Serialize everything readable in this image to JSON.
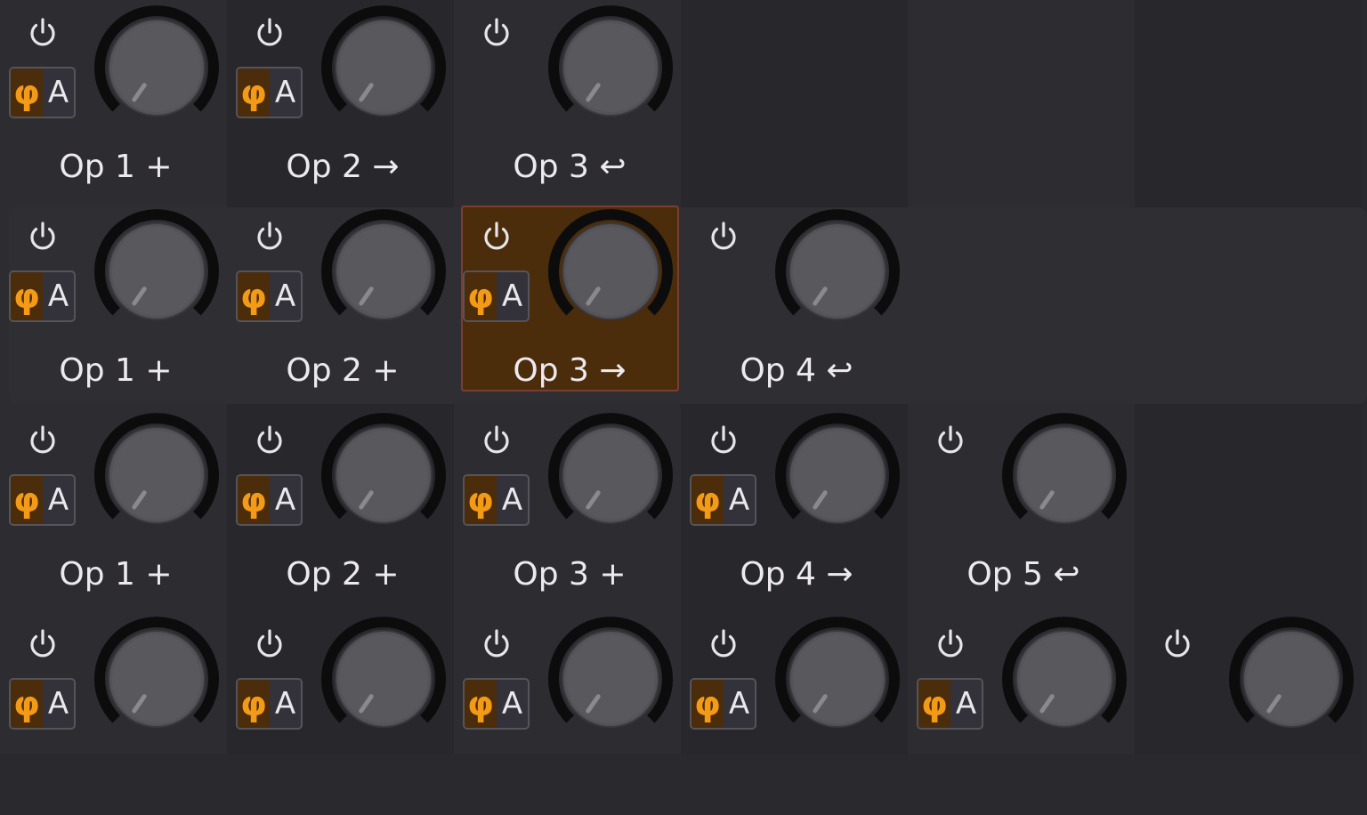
{
  "icons": {
    "power": "power-icon",
    "knob": "knob"
  },
  "colors": {
    "accent": "#f39a16",
    "selected_bg": "#4b2c0b",
    "selected_border": "#7a3d31"
  },
  "phase_toggle": {
    "phase_symbol": "φ",
    "amplitude_symbol": "A"
  },
  "rows": [
    {
      "cells": [
        {
          "label": "Op 1 +",
          "phase": true,
          "selected": false
        },
        {
          "label": "Op 2 →",
          "phase": true,
          "selected": false
        },
        {
          "label": "Op 3 ↩",
          "phase": false,
          "selected": false
        }
      ]
    },
    {
      "cells": [
        {
          "label": "Op 1 +",
          "phase": true,
          "selected": false
        },
        {
          "label": "Op 2 +",
          "phase": true,
          "selected": false
        },
        {
          "label": "Op 3 →",
          "phase": true,
          "selected": true
        },
        {
          "label": "Op 4 ↩",
          "phase": false,
          "selected": false
        }
      ]
    },
    {
      "cells": [
        {
          "label": "Op 1 +",
          "phase": true,
          "selected": false
        },
        {
          "label": "Op 2 +",
          "phase": true,
          "selected": false
        },
        {
          "label": "Op 3 +",
          "phase": true,
          "selected": false
        },
        {
          "label": "Op 4 →",
          "phase": true,
          "selected": false
        },
        {
          "label": "Op 5 ↩",
          "phase": false,
          "selected": false
        }
      ]
    },
    {
      "cells": [
        {
          "label": "",
          "phase": true,
          "selected": false
        },
        {
          "label": "",
          "phase": true,
          "selected": false
        },
        {
          "label": "",
          "phase": true,
          "selected": false
        },
        {
          "label": "",
          "phase": true,
          "selected": false
        },
        {
          "label": "",
          "phase": true,
          "selected": false
        },
        {
          "label": "",
          "phase": false,
          "selected": false
        }
      ]
    }
  ]
}
